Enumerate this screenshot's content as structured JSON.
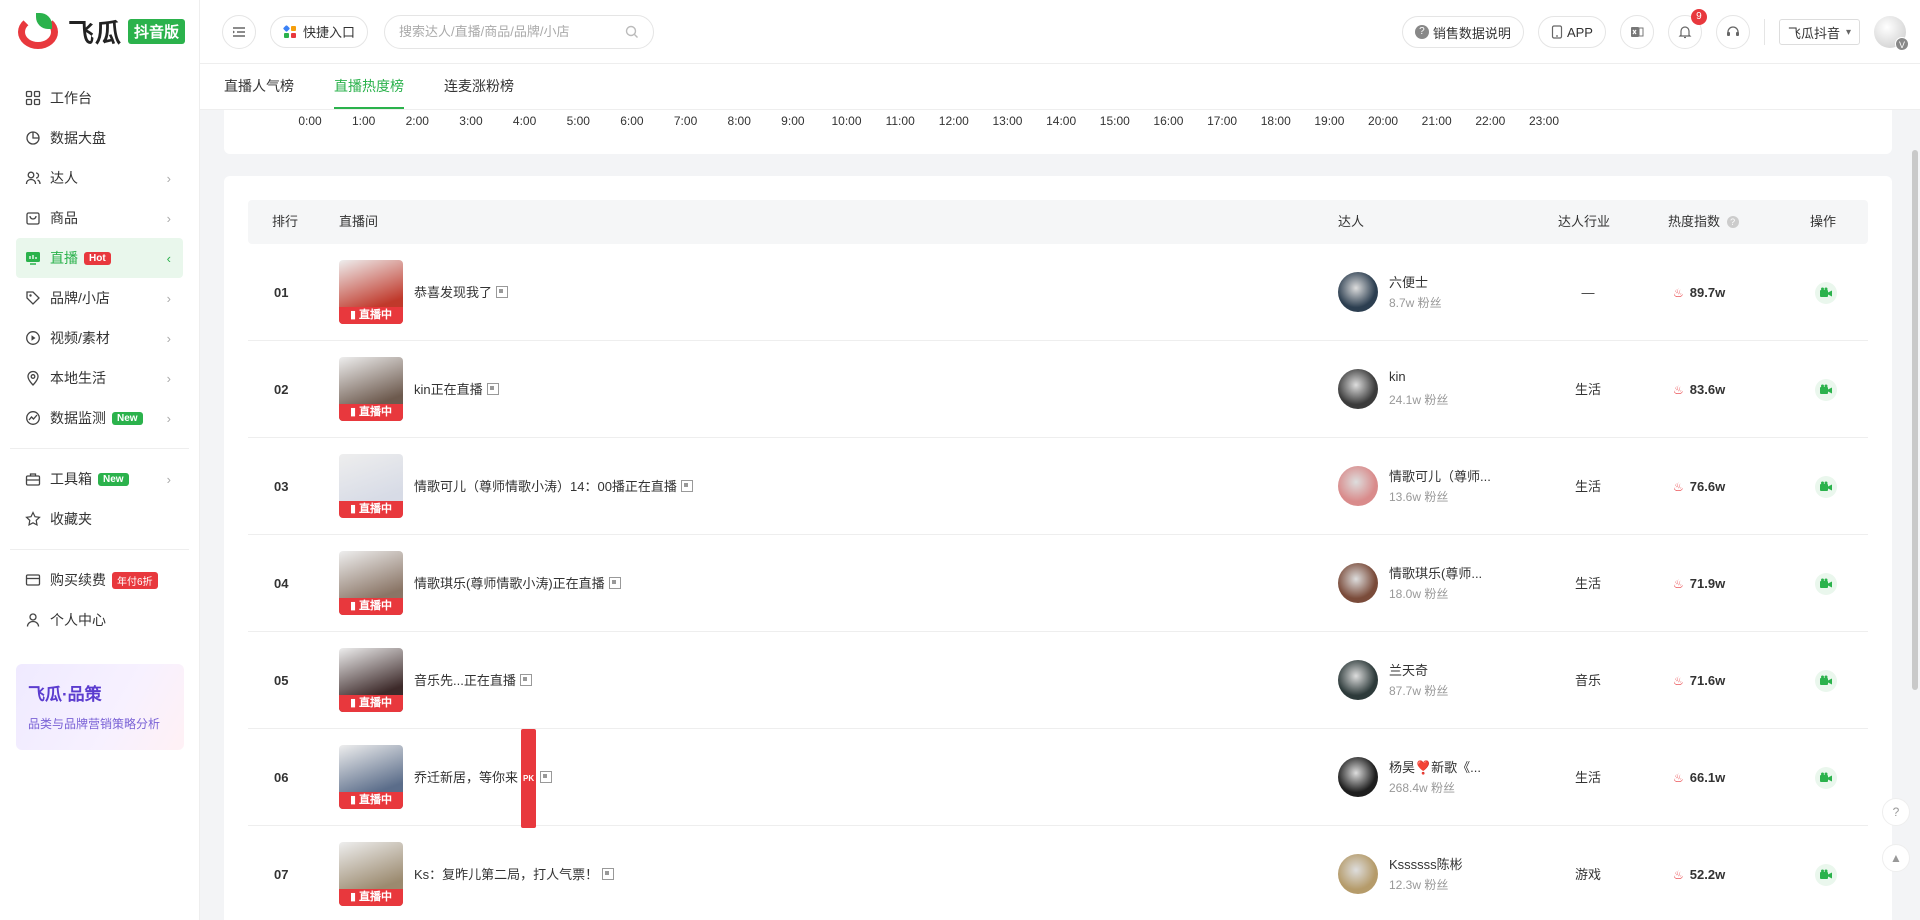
{
  "brand": {
    "name": "飞瓜",
    "badge": "抖音版"
  },
  "sidebar": {
    "items": [
      {
        "label": "工作台",
        "icon": "grid-icon",
        "chevron": false
      },
      {
        "label": "数据大盘",
        "icon": "pie-chart-icon",
        "chevron": false
      },
      {
        "label": "达人",
        "icon": "people-icon",
        "chevron": true
      },
      {
        "label": "商品",
        "icon": "bag-icon",
        "chevron": true
      },
      {
        "label": "直播",
        "icon": "tv-icon",
        "chevron": true,
        "tag": "Hot",
        "active": true
      },
      {
        "label": "品牌/小店",
        "icon": "tag-icon",
        "chevron": true
      },
      {
        "label": "视频/素材",
        "icon": "play-circle-icon",
        "chevron": true
      },
      {
        "label": "本地生活",
        "icon": "location-icon",
        "chevron": true
      },
      {
        "label": "数据监测",
        "icon": "monitor-chart-icon",
        "chevron": true,
        "tag": "New"
      }
    ],
    "tools": [
      {
        "label": "工具箱",
        "icon": "toolbox-icon",
        "chevron": true,
        "tag": "New"
      },
      {
        "label": "收藏夹",
        "icon": "star-icon",
        "chevron": false
      }
    ],
    "account": [
      {
        "label": "购买续费",
        "icon": "card-icon",
        "chevron": false,
        "tag": "年付6折"
      },
      {
        "label": "个人中心",
        "icon": "user-icon",
        "chevron": false
      }
    ],
    "promo": {
      "title": "飞瓜·品策",
      "subtitle": "品类与品牌营销策略分析"
    }
  },
  "topbar": {
    "quick_entry": "快捷入口",
    "search_placeholder": "搜索达人/直播/商品/品牌/小店",
    "sales_note": "销售数据说明",
    "app": "APP",
    "notifications": "9",
    "platform_select": "飞瓜抖音",
    "avatar_badge": "V"
  },
  "tabs": [
    {
      "label": "直播人气榜",
      "active": false
    },
    {
      "label": "直播热度榜",
      "active": true
    },
    {
      "label": "连麦涨粉榜",
      "active": false
    }
  ],
  "hours": [
    "0:00",
    "1:00",
    "2:00",
    "3:00",
    "4:00",
    "5:00",
    "6:00",
    "7:00",
    "8:00",
    "9:00",
    "10:00",
    "11:00",
    "12:00",
    "13:00",
    "14:00",
    "15:00",
    "16:00",
    "17:00",
    "18:00",
    "19:00",
    "20:00",
    "21:00",
    "22:00",
    "23:00"
  ],
  "table": {
    "headers": {
      "rank": "排行",
      "room": "直播间",
      "talent": "达人",
      "industry": "达人行业",
      "heat": "热度指数",
      "action": "操作"
    },
    "live_label": "直播中",
    "rows": [
      {
        "rank": "01",
        "title": "恭喜发现我了",
        "pk": false,
        "talent": "六便士",
        "fans": "8.7w 粉丝",
        "industry": "—",
        "heat": "89.7w",
        "thumb": "#c0392b",
        "avatar": "#2c3e50"
      },
      {
        "rank": "02",
        "title": "kin正在直播",
        "pk": false,
        "talent": "kin",
        "fans": "24.1w 粉丝",
        "industry": "生活",
        "heat": "83.6w",
        "thumb": "#6d5a4e",
        "avatar": "#3b3b3b"
      },
      {
        "rank": "03",
        "title": "情歌可儿（尊师情歌小涛）14：00播正在直播",
        "pk": false,
        "talent": "情歌可儿（尊师...",
        "fans": "13.6w 粉丝",
        "industry": "生活",
        "heat": "76.6w",
        "thumb": "#d7dbe6",
        "avatar": "#d98b8b"
      },
      {
        "rank": "04",
        "title": "情歌琪乐(尊师情歌小涛)正在直播",
        "pk": false,
        "talent": "情歌琪乐(尊师...",
        "fans": "18.0w 粉丝",
        "industry": "生活",
        "heat": "71.9w",
        "thumb": "#8a7566",
        "avatar": "#7a4b3a"
      },
      {
        "rank": "05",
        "title": "音乐先...正在直播",
        "pk": false,
        "talent": "兰天奇",
        "fans": "87.7w 粉丝",
        "industry": "音乐",
        "heat": "71.6w",
        "thumb": "#3d2a2a",
        "avatar": "#2d3a3a"
      },
      {
        "rank": "06",
        "title": "乔迁新居，等你来",
        "pk": true,
        "talent": "杨昊❣️新歌《...",
        "fans": "268.4w 粉丝",
        "industry": "生活",
        "heat": "66.1w",
        "thumb": "#5b6d8a",
        "avatar": "#1e1e1e"
      },
      {
        "rank": "07",
        "title": "Ks：复昨儿第二局，打人气票！",
        "pk": false,
        "talent": "Kssssss陈彬",
        "fans": "12.3w 粉丝",
        "industry": "游戏",
        "heat": "52.2w",
        "thumb": "#9b8a6f",
        "avatar": "#b59b6a"
      }
    ]
  },
  "colors": {
    "accent": "#2bb24c",
    "danger": "#e8383d"
  }
}
